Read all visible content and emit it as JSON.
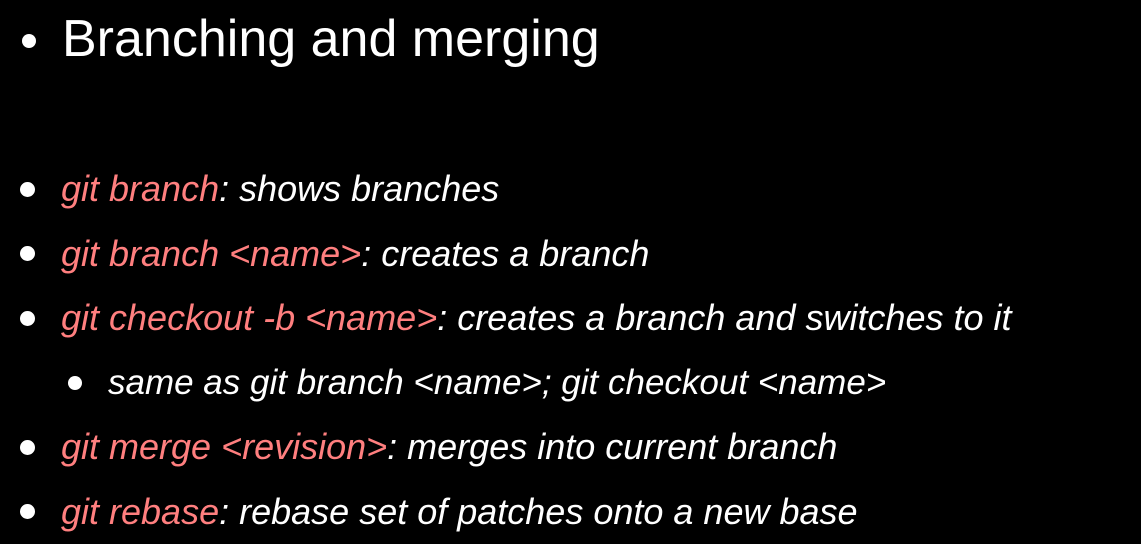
{
  "slide": {
    "title": "Branching and merging",
    "accent_color": "#ff7f7f",
    "text_color": "#ffffff",
    "background_color": "#000000",
    "bullets": [
      {
        "level": 1,
        "command": "git branch",
        "description": ": shows branches"
      },
      {
        "level": 1,
        "command": "git branch <name>",
        "description": ": creates a branch"
      },
      {
        "level": 1,
        "command": "git checkout -b <name>",
        "description": ": creates a branch and switches to it"
      },
      {
        "level": 2,
        "command": "",
        "description": "same as git branch <name>; git checkout <name>"
      },
      {
        "level": 1,
        "command": "git merge <revision>",
        "description": ": merges into current branch"
      },
      {
        "level": 1,
        "command": "git rebase",
        "description": ": rebase set of patches onto a new base"
      }
    ]
  }
}
